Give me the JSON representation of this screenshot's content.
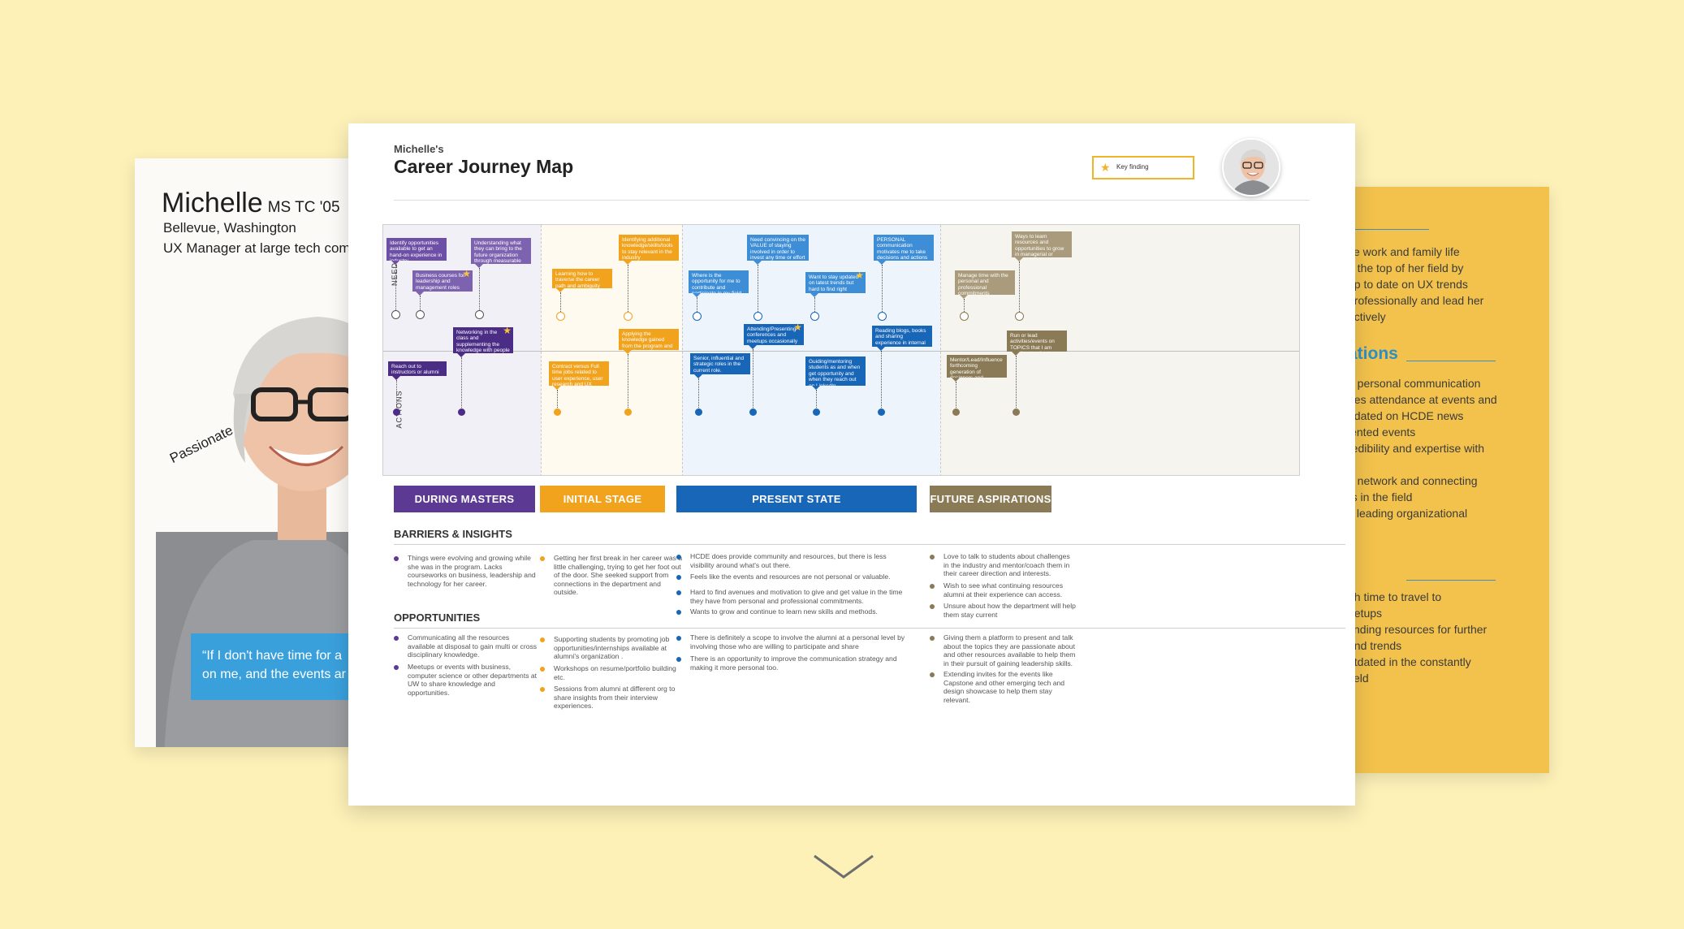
{
  "persona": {
    "name": "Michelle",
    "degree": "MS TC '05",
    "location": "Bellevue, Washington",
    "role": "UX Manager at large tech comp",
    "tag": "Passionate",
    "quote_line1": "“If I don't have time for a",
    "quote_line2": "on me, and the events ar"
  },
  "side_card": {
    "lines_top": [
      "ce work and family life",
      "n the top of her field by",
      "up to date on UX trends",
      "professionally and lead her",
      "ectively"
    ],
    "heading": "ations",
    "lines_mid": [
      "d personal communication",
      "ges attendance at events and",
      "pdated on HCDE news",
      "iented events",
      "redibility and expertise with",
      "",
      "g network and connecting",
      "rs in the field",
      "y leading organizational"
    ],
    "lines_bottom": [
      "gh time to travel to",
      "eetups",
      "finding resources for further",
      "and trends",
      "utdated in the constantly",
      "field"
    ]
  },
  "map": {
    "subtitle": "Michelle's",
    "title": "Career Journey Map",
    "key_label": "Key finding",
    "row_needs": "NEEDS",
    "row_actions": "ACTIONS",
    "colors": {
      "masters": "#5c3a94",
      "initial": "#f2a31e",
      "present": "#1866b8",
      "present_light": "#3d8ed6",
      "future": "#8a7a55",
      "future_light": "#a99b7b",
      "star": "#f6c53a"
    },
    "needs_notes": [
      "Identify opportunities available to get an hand-on experience in industry",
      "Business courses for leadership and management roles",
      "Understanding what they can bring to the future organization through measurable results",
      "Learning how to traverse the career path and ambiguity around the role",
      "Identifying additional knowledge/skills/tools to stay relevant in the industry",
      "Where is the opportunity for me to contribute and participate in my field of interest?",
      "Need convincing on the VALUE of staying involved in order to invest any time or effort",
      "Want to stay updated on latest trends but hard to find right resources",
      "PERSONAL communication motivates me to take decisions and actions",
      "Manage time with the personal and professional commitments",
      "Ways to learn resources and opportunities to grow in managerial or leadership roles"
    ],
    "action_notes": [
      "Reach out to instructors or alumni for internship",
      "Networking in the class and supplementing the knowledge with people in the department",
      "Contract versus Full time jobs related to user experience, user research and UX writing",
      "Applying the knowledge gained from the program and learning on the go",
      "Senior, influential and strategic roles in the current role.",
      "Attending/Presenting conferences and meetups occasionally",
      "Guiding/mentoring students as and when get opportunity and when they reach out on LinkedIn",
      "Reading blogs, books and sharing experience in internal company groups",
      "Mentor/Lead/Influence forthcoming generation of designers and researchers",
      "Run or lead activities/events on TOPICS that I am passionate about"
    ],
    "stages": [
      "DURING MASTERS",
      "INITIAL STAGE",
      "PRESENT STATE",
      "FUTURE ASPIRATIONS"
    ],
    "barriers_title": "BARRIERS & INSIGHTS",
    "barriers": [
      [
        "Things were evolving and growing while she was in the program. Lacks courseworks on business, leadership and technology for her career."
      ],
      [
        "Getting her first break in her career was a little challenging, trying to get her foot out of the door. She seeked support from connections in the department and outside."
      ],
      [
        "HCDE does provide community and resources, but there is less visibility around what's out there.",
        "Feels like the events and resources are not personal or valuable.",
        "Hard to find avenues and motivation to give and get value in the time they have from personal and professional commitments.",
        "Wants to grow and continue to learn new skills and methods."
      ],
      [
        "Love to talk to students about challenges in the industry and mentor/coach them in their career direction and interests.",
        "Wish to see what continuing resources alumni at their experience can access.",
        "Unsure about how the department will help them stay current"
      ]
    ],
    "opportunities_title": "OPPORTUNITIES",
    "opportunities": [
      [
        "Communicating all the resources available at disposal to gain multi or cross disciplinary knowledge.",
        "Meetups or events with business, computer science or other departments at UW to share knowledge and opportunities."
      ],
      [
        "Supporting students by promoting job opportunities/internships available at alumni's organization .",
        "Workshops on resume/portfolio building etc.",
        "Sessions from alumni at different org to share insights from their interview experiences."
      ],
      [
        "There is definitely a scope to involve the alumni at a personal level by involving those who are willing to participate and share",
        "There is an opportunity to improve the communication strategy and making it more personal too."
      ],
      [
        "Giving them a platform to present and talk about the topics they are passionate about and other resources available to help them in their pursuit of gaining leadership skills.",
        "Extending invites for the events like Capstone and other emerging tech and design showcase to help them stay relevant."
      ]
    ]
  },
  "nav": {
    "scroll_icon": "chevron-down-icon"
  }
}
